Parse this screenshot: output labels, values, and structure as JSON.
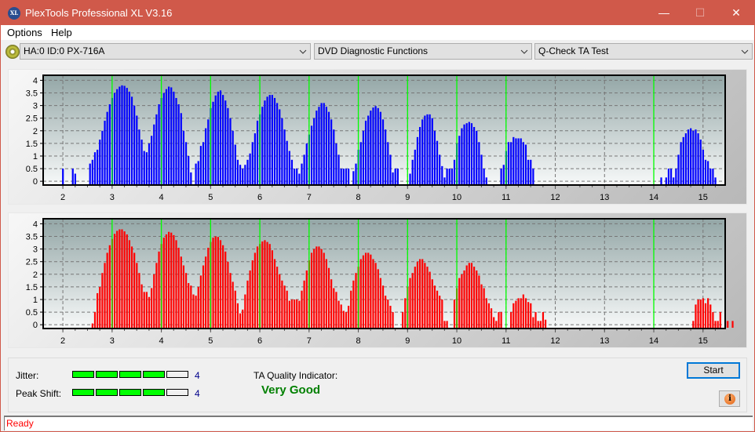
{
  "window": {
    "title": "PlexTools Professional XL V3.16",
    "app_icon_text": "XL",
    "minimize": "—",
    "maximize": "☐",
    "close": "✕"
  },
  "menu": {
    "items": [
      "Options",
      "Help"
    ]
  },
  "toolbar": {
    "drive": "HA:0 ID:0  PX-716A",
    "function": "DVD Diagnostic Functions",
    "test": "Q-Check TA Test"
  },
  "colors": {
    "title_bar": "#d0594a",
    "top_bars": "#0000ff",
    "bottom_bars": "#ff0000",
    "marker_lines": "#00ff00",
    "indicator_on": "#00ff00",
    "quality_text": "#008000",
    "status_text": "#ff0000"
  },
  "indicators": {
    "jitter_label": "Jitter:",
    "jitter_value": "4",
    "jitter_level": 4,
    "peak_shift_label": "Peak Shift:",
    "peak_shift_value": "4",
    "peak_shift_level": 4,
    "max_level": 5,
    "ta_label": "TA Quality Indicator:",
    "ta_value": "Very Good"
  },
  "buttons": {
    "start": "Start",
    "info": "i"
  },
  "status": {
    "text": "Ready"
  },
  "chart_data": [
    {
      "type": "bar",
      "name": "top-chart",
      "title": "",
      "xlabel": "",
      "ylabel": "",
      "xlim": [
        1.6,
        15.45
      ],
      "ylim": [
        -0.15,
        4.2
      ],
      "xticks": [
        2,
        3,
        4,
        5,
        6,
        7,
        8,
        9,
        10,
        11,
        12,
        13,
        14,
        15
      ],
      "yticks": [
        0,
        0.5,
        1,
        1.5,
        2,
        2.5,
        3,
        3.5,
        4
      ],
      "ytick_labels": [
        "0",
        "0.5",
        "1",
        "1.5",
        "2",
        "2.5",
        "3",
        "3.5",
        "4"
      ],
      "grid": true,
      "marker_lines": [
        3,
        4,
        5,
        6,
        7,
        8,
        9,
        10,
        11,
        14
      ],
      "bar_color": "#0000ff",
      "x_start": 1.95,
      "x_step": 0.05,
      "values": [
        0,
        0.5,
        0,
        0,
        0,
        0.5,
        0.3,
        0,
        0,
        0,
        0,
        0,
        0.7,
        0.85,
        1.15,
        1.25,
        1.65,
        2.0,
        2.4,
        2.75,
        3.05,
        3.3,
        3.5,
        3.65,
        3.75,
        3.8,
        3.78,
        3.7,
        3.55,
        3.35,
        3.0,
        2.6,
        2.05,
        1.65,
        1.2,
        1.15,
        1.5,
        1.8,
        2.25,
        2.65,
        3.05,
        3.3,
        3.5,
        3.65,
        3.75,
        3.72,
        3.55,
        3.3,
        3.05,
        2.7,
        2.0,
        1.55,
        1.0,
        0.35,
        0,
        0.7,
        0.8,
        1.4,
        1.55,
        2.1,
        2.45,
        2.9,
        3.15,
        3.4,
        3.55,
        3.6,
        3.42,
        3.2,
        2.9,
        2.5,
        2.0,
        1.45,
        0.85,
        0.65,
        0.5,
        0.65,
        0.85,
        1.1,
        1.55,
        1.9,
        2.4,
        2.65,
        2.95,
        3.2,
        3.35,
        3.42,
        3.42,
        3.3,
        3.1,
        2.85,
        2.5,
        2.05,
        1.6,
        1.2,
        0.85,
        0.5,
        0.5,
        0.3,
        0.7,
        1.05,
        1.5,
        1.85,
        2.2,
        2.5,
        2.8,
        2.95,
        3.1,
        3.1,
        2.95,
        2.75,
        2.45,
        2.05,
        1.5,
        1.05,
        0.5,
        0.5,
        0.5,
        0.5,
        0,
        0.4,
        0.7,
        1.25,
        1.55,
        2.0,
        2.4,
        2.6,
        2.8,
        2.92,
        2.98,
        2.9,
        2.75,
        2.45,
        2.05,
        1.55,
        1.05,
        0.35,
        0.5,
        0.5,
        0,
        0,
        0,
        0,
        0.3,
        0.85,
        1.25,
        1.75,
        2.15,
        2.45,
        2.6,
        2.65,
        2.65,
        2.5,
        2.0,
        1.6,
        1.05,
        0.6,
        0.15,
        0.5,
        0.5,
        0.5,
        0.85,
        1.5,
        1.8,
        2.1,
        2.25,
        2.3,
        2.35,
        2.3,
        2.15,
        2.0,
        1.55,
        1.05,
        0.5,
        0.15,
        0,
        0,
        0,
        0,
        0,
        0.5,
        0.65,
        1.2,
        1.55,
        1.55,
        1.75,
        1.7,
        1.7,
        1.7,
        1.55,
        1.45,
        0.85,
        0.85,
        0.5,
        0,
        0,
        0,
        0,
        0,
        0,
        0,
        0,
        0,
        0,
        0,
        0,
        0,
        0,
        0,
        0,
        0,
        0,
        0,
        0,
        0,
        0,
        0,
        0,
        0,
        0,
        0,
        0,
        0,
        0,
        0,
        0,
        0,
        0,
        0,
        0,
        0,
        0,
        0,
        0,
        0,
        0,
        0,
        0,
        0,
        0,
        0,
        0,
        0,
        0,
        0,
        0.15,
        0,
        0.15,
        0.5,
        0.5,
        0.15,
        0.5,
        1.05,
        1.55,
        1.75,
        1.9,
        2.05,
        2.1,
        2.0,
        2.05,
        1.9,
        1.65,
        1.25,
        0.85,
        0.8,
        0.5,
        0.5,
        0.15,
        0,
        0,
        0,
        0,
        0,
        0,
        0,
        0,
        0,
        0,
        0,
        0,
        0,
        0,
        0,
        0,
        0,
        0,
        0,
        0,
        0,
        0,
        0
      ]
    },
    {
      "type": "bar",
      "name": "bottom-chart",
      "title": "",
      "xlabel": "",
      "ylabel": "",
      "xlim": [
        1.6,
        15.45
      ],
      "ylim": [
        -0.15,
        4.2
      ],
      "xticks": [
        2,
        3,
        4,
        5,
        6,
        7,
        8,
        9,
        10,
        11,
        12,
        13,
        14,
        15
      ],
      "yticks": [
        0,
        0.5,
        1,
        1.5,
        2,
        2.5,
        3,
        3.5,
        4
      ],
      "ytick_labels": [
        "0",
        "0.5",
        "1",
        "1.5",
        "2",
        "2.5",
        "3",
        "3.5",
        "4"
      ],
      "grid": true,
      "marker_lines": [
        3,
        4,
        5,
        6,
        7,
        8,
        9,
        10,
        11,
        14
      ],
      "bar_color": "#ff0000",
      "x_start": 1.95,
      "x_step": 0.05,
      "values": [
        0,
        0,
        0,
        0,
        0,
        0,
        0,
        0,
        0,
        0,
        0,
        0,
        0,
        0.05,
        0.5,
        1.25,
        1.5,
        2.05,
        2.45,
        2.85,
        3.15,
        3.4,
        3.6,
        3.72,
        3.78,
        3.78,
        3.7,
        3.58,
        3.35,
        3.1,
        2.85,
        2.45,
        2.05,
        1.6,
        1.3,
        1.3,
        1.1,
        1.45,
        2.0,
        2.45,
        2.9,
        3.2,
        3.45,
        3.58,
        3.68,
        3.65,
        3.55,
        3.35,
        3.05,
        2.7,
        2.35,
        2.05,
        1.65,
        1.55,
        1.2,
        1.15,
        1.5,
        1.95,
        2.35,
        2.7,
        3.05,
        3.28,
        3.45,
        3.5,
        3.48,
        3.35,
        3.15,
        2.9,
        2.5,
        2.05,
        1.7,
        1.35,
        0.85,
        0.45,
        0.6,
        1.2,
        1.75,
        2.15,
        2.55,
        2.85,
        3.1,
        3.2,
        3.3,
        3.35,
        3.28,
        3.2,
        2.95,
        2.6,
        2.3,
        2.0,
        1.75,
        1.55,
        1.35,
        0.95,
        1.0,
        1.0,
        1.0,
        0.95,
        1.35,
        1.75,
        2.15,
        2.55,
        2.85,
        3.0,
        3.1,
        3.1,
        3.0,
        2.85,
        2.6,
        2.25,
        1.8,
        1.45,
        1.3,
        0.95,
        0.8,
        0.55,
        0.5,
        0.75,
        1.35,
        1.75,
        2.05,
        2.3,
        2.6,
        2.75,
        2.85,
        2.85,
        2.78,
        2.6,
        2.45,
        2.2,
        1.85,
        1.55,
        1.15,
        1.0,
        0.75,
        0.5,
        0,
        0,
        0,
        0.5,
        1.05,
        1.5,
        1.85,
        2.05,
        2.3,
        2.5,
        2.6,
        2.6,
        2.45,
        2.3,
        2.1,
        1.8,
        1.55,
        1.35,
        1.15,
        1.0,
        0.15,
        0.15,
        0,
        0,
        1.0,
        1.45,
        1.85,
        2.0,
        2.15,
        2.35,
        2.45,
        2.45,
        2.3,
        2.15,
        1.95,
        1.6,
        1.45,
        1.05,
        0.85,
        0.65,
        0.3,
        0.15,
        0.5,
        0.5,
        0,
        0,
        0,
        0.5,
        0.85,
        0.95,
        1.05,
        1.05,
        1.2,
        1.05,
        0.9,
        0.85,
        0.3,
        0.5,
        0.15,
        0.15,
        0.5,
        0.2,
        0,
        0,
        0,
        0,
        0,
        0,
        0,
        0,
        0,
        0,
        0,
        0,
        0,
        0,
        0,
        0,
        0,
        0,
        0,
        0,
        0,
        0,
        0,
        0,
        0,
        0,
        0,
        0,
        0,
        0,
        0,
        0,
        0,
        0,
        0,
        0,
        0,
        0,
        0,
        0,
        0,
        0,
        0,
        0,
        0,
        0,
        0,
        0,
        0,
        0,
        0,
        0,
        0,
        0,
        0,
        0,
        0,
        0,
        0,
        0.15,
        0.8,
        1.0,
        1.0,
        1.05,
        0.85,
        1.05,
        0.8,
        0.5,
        0.15,
        0.15,
        0.5,
        0,
        0.15,
        0.15,
        0,
        0.15,
        0,
        0,
        0,
        0,
        0,
        0,
        0,
        0,
        0,
        0,
        0,
        0,
        0,
        0,
        0,
        0,
        0
      ]
    }
  ]
}
